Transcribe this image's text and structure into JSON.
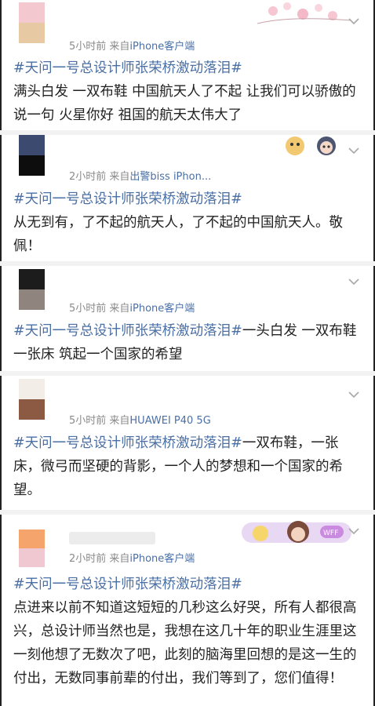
{
  "posts": [
    {
      "meta": "5小时前 来自",
      "source": "iPhone客户端",
      "tag": "#天问一号总设计师张荣桥激动落泪#",
      "text": "满头白发 一双布鞋 中国航天人了不起 让我们可以骄傲的说一句 火星你好 祖国的航天太伟大了",
      "avatar_colors": [
        "#f3c8cf",
        "#e7c9a4"
      ]
    },
    {
      "meta": "2小时前 来自",
      "source": "出警biss iPhon...",
      "tag": "#天问一号总设计师张荣桥激动落泪#",
      "text": "从无到有，了不起的航天人，了不起的中国航天人。敬佩！",
      "avatar_colors": [
        "#3c4a6f",
        "#0d0d0d"
      ]
    },
    {
      "meta": "5小时前 来自",
      "source": "iPhone客户端",
      "tag": "#天问一号总设计师张荣桥激动落泪#",
      "text": "一头白发 一双布鞋 一张床  筑起一个国家的希望",
      "avatar_colors": [
        "#1c1c1c",
        "#8f857e"
      ]
    },
    {
      "meta": "5小时前 来自",
      "source": "HUAWEI P40 5G",
      "tag": "#天问一号总设计师张荣桥激动落泪#",
      "text": "一双布鞋，一张床，微弓而坚硬的背影，一个人的梦想和一个国家的希望。",
      "avatar_colors": [
        "#f2ede6",
        "#8c5a43"
      ]
    },
    {
      "meta": "2小时前 来自",
      "source": "iPhone客户端",
      "tag": "#天问一号总设计师张荣桥激动落泪#",
      "text": "点进来以前不知道这短短的几秒这么好哭，所有人都很高兴，总设计师当然也是，我想在这几十年的职业生涯里这一刻他想了无数次了吧，此刻的脑海里回想的是这一生的付出，无数同事前辈的付出，我们等到了，您们值得！",
      "avatar_colors": [
        "#f5a56c",
        "#f0c8d2"
      ]
    }
  ],
  "icons": {
    "chevron": "chevron-down-icon"
  },
  "colors": {
    "topic_link": "#4a6fa5",
    "meta_gray": "#8a8a8a"
  }
}
